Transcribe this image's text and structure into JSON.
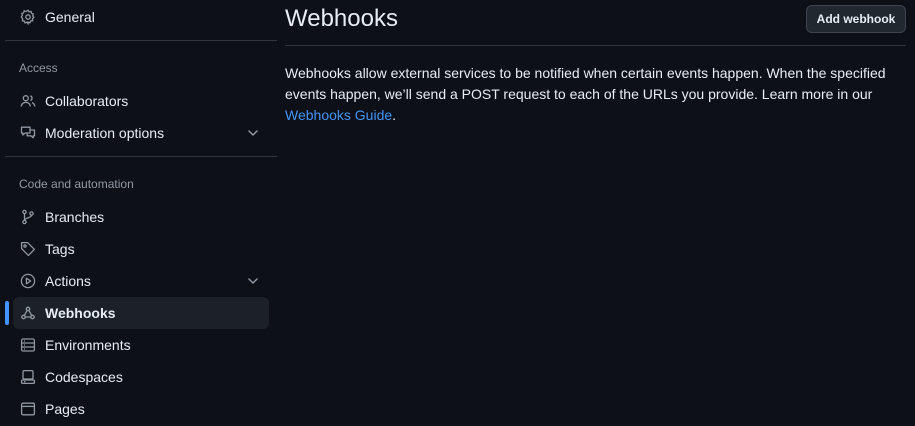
{
  "sidebar": {
    "top_item": {
      "label": "General",
      "icon": "gear-icon"
    },
    "groups": {
      "access": {
        "title": "Access",
        "items": [
          {
            "label": "Collaborators",
            "icon": "people-icon"
          },
          {
            "label": "Moderation options",
            "icon": "comment-discussion-icon",
            "expandable": true
          }
        ]
      },
      "code_automation": {
        "title": "Code and automation",
        "items": [
          {
            "label": "Branches",
            "icon": "git-branch-icon"
          },
          {
            "label": "Tags",
            "icon": "tag-icon"
          },
          {
            "label": "Actions",
            "icon": "play-icon",
            "expandable": true
          },
          {
            "label": "Webhooks",
            "icon": "webhook-icon",
            "active": true
          },
          {
            "label": "Environments",
            "icon": "server-icon"
          },
          {
            "label": "Codespaces",
            "icon": "codespaces-icon"
          },
          {
            "label": "Pages",
            "icon": "browser-icon"
          }
        ]
      }
    }
  },
  "main": {
    "title": "Webhooks",
    "add_button_label": "Add webhook",
    "description_text": "Webhooks allow external services to be notified when certain events happen. When the specified events happen, we’ll send a POST request to each of the URLs you provide. Learn more in our ",
    "description_link": "Webhooks Guide",
    "description_end": "."
  },
  "colors": {
    "background": "#0d1117",
    "active_item_bg": "#1c2128",
    "accent": "#4493f8",
    "border": "#30363d",
    "muted_text": "#9198a1"
  }
}
